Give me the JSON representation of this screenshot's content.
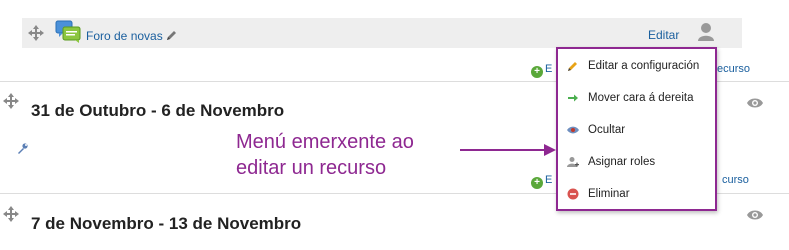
{
  "forum_row": {
    "link_label": "Foro de novas",
    "edit_label": "Editar"
  },
  "add_resource_label_fragment_left": "E",
  "add_resource_label_fragment_right": "ecurso",
  "add_resource_label_fragment_right_2": "curso",
  "sections": [
    {
      "title": "31 de Outubro - 6 de Novembro"
    },
    {
      "title": "7 de Novembro - 13 de Novembro"
    }
  ],
  "annotation": {
    "line1": "Menú emerxente ao",
    "line2": "editar un recurso"
  },
  "menu": {
    "items": [
      {
        "label": "Editar a configuración",
        "icon": "pencil-icon"
      },
      {
        "label": "Mover cara á dereita",
        "icon": "arrow-right-icon"
      },
      {
        "label": "Ocultar",
        "icon": "eye-icon"
      },
      {
        "label": "Asignar roles",
        "icon": "add-user-icon"
      },
      {
        "label": "Eliminar",
        "icon": "delete-icon"
      }
    ]
  },
  "colors": {
    "link": "#1a5f9e",
    "annotation": "#8e2891",
    "menu_border": "#8e2891",
    "add_green": "#5aa83a",
    "delete_red": "#d9534f"
  }
}
